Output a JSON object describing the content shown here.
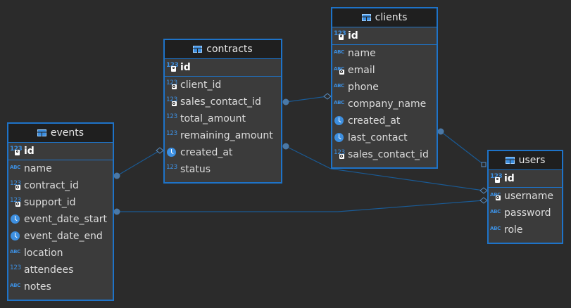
{
  "entities": {
    "contracts": {
      "title": "contracts",
      "pk": {
        "name": "id",
        "type_icon": "number-key-icon"
      },
      "columns": [
        {
          "name": "client_id",
          "type_icon": "number-fk-icon"
        },
        {
          "name": "sales_contact_id",
          "type_icon": "number-fk-icon"
        },
        {
          "name": "total_amount",
          "type_icon": "number-icon"
        },
        {
          "name": "remaining_amount",
          "type_icon": "number-icon"
        },
        {
          "name": "created_at",
          "type_icon": "clock-icon"
        },
        {
          "name": "status",
          "type_icon": "number-icon"
        }
      ]
    },
    "clients": {
      "title": "clients",
      "pk": {
        "name": "id",
        "type_icon": "number-key-icon"
      },
      "columns": [
        {
          "name": "name",
          "type_icon": "text-icon"
        },
        {
          "name": "email",
          "type_icon": "text-key-icon"
        },
        {
          "name": "phone",
          "type_icon": "text-icon"
        },
        {
          "name": "company_name",
          "type_icon": "text-icon"
        },
        {
          "name": "created_at",
          "type_icon": "clock-icon"
        },
        {
          "name": "last_contact",
          "type_icon": "clock-icon"
        },
        {
          "name": "sales_contact_id",
          "type_icon": "number-fk-icon"
        }
      ]
    },
    "events": {
      "title": "events",
      "pk": {
        "name": "id",
        "type_icon": "number-key-icon"
      },
      "columns": [
        {
          "name": "name",
          "type_icon": "text-icon"
        },
        {
          "name": "contract_id",
          "type_icon": "number-fk-icon"
        },
        {
          "name": "support_id",
          "type_icon": "number-fk-icon"
        },
        {
          "name": "event_date_start",
          "type_icon": "clock-icon"
        },
        {
          "name": "event_date_end",
          "type_icon": "clock-icon"
        },
        {
          "name": "location",
          "type_icon": "text-icon"
        },
        {
          "name": "attendees",
          "type_icon": "number-icon"
        },
        {
          "name": "notes",
          "type_icon": "text-icon"
        }
      ]
    },
    "users": {
      "title": "users",
      "pk": {
        "name": "id",
        "type_icon": "number-key-icon"
      },
      "columns": [
        {
          "name": "username",
          "type_icon": "text-key-icon"
        },
        {
          "name": "password",
          "type_icon": "text-icon"
        },
        {
          "name": "role",
          "type_icon": "text-icon"
        }
      ]
    }
  },
  "relationships": [
    {
      "from": "contracts.client_id",
      "to": "clients.id"
    },
    {
      "from": "contracts.sales_contact_id",
      "to": "users.id"
    },
    {
      "from": "clients.sales_contact_id",
      "to": "users.id"
    },
    {
      "from": "events.contract_id",
      "to": "contracts.id"
    },
    {
      "from": "events.support_id",
      "to": "users.id"
    }
  ],
  "colors": {
    "background": "#2b2b2b",
    "entity_border": "#1e73c8",
    "entity_fill": "#3b3b3b",
    "header_fill": "#1f1f1f",
    "link": "#1a5a94",
    "type_icon": "#3d8fe0"
  }
}
